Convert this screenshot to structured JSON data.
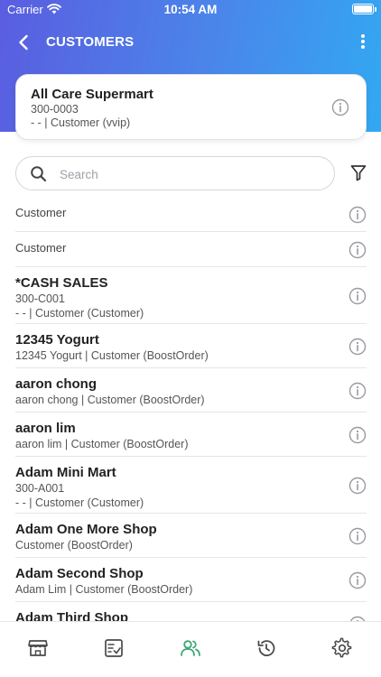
{
  "status_bar": {
    "carrier": "Carrier",
    "time": "10:54 AM"
  },
  "nav": {
    "title": "CUSTOMERS"
  },
  "selected_customer": {
    "name": "All Care Supermart",
    "code": "300-0003",
    "meta": "- - | Customer (vvip)"
  },
  "search": {
    "placeholder": "Search",
    "value": ""
  },
  "customers": [
    {
      "name": "",
      "code": "",
      "meta": "Customer"
    },
    {
      "name": "",
      "code": "",
      "meta": "Customer"
    },
    {
      "name": "*CASH SALES",
      "code": "300-C001",
      "meta": "- - | Customer (Customer)"
    },
    {
      "name": "12345 Yogurt",
      "code": "",
      "meta": "12345 Yogurt | Customer (BoostOrder)"
    },
    {
      "name": "aaron chong",
      "code": "",
      "meta": "aaron chong | Customer (BoostOrder)"
    },
    {
      "name": "aaron lim",
      "code": "",
      "meta": "aaron lim | Customer (BoostOrder)"
    },
    {
      "name": "Adam Mini Mart",
      "code": "300-A001",
      "meta": "- - | Customer (Customer)"
    },
    {
      "name": "Adam One More Shop",
      "code": "",
      "meta": "Customer (BoostOrder)"
    },
    {
      "name": "Adam Second Shop",
      "code": "",
      "meta": "Adam Lim | Customer (BoostOrder)"
    },
    {
      "name": "Adam Third Shop",
      "code": "",
      "meta": ""
    }
  ],
  "tabs": [
    {
      "icon": "store-icon",
      "active": false
    },
    {
      "icon": "order-checklist-icon",
      "active": false
    },
    {
      "icon": "customers-icon",
      "active": true
    },
    {
      "icon": "history-icon",
      "active": false
    },
    {
      "icon": "settings-gear-icon",
      "active": false
    }
  ],
  "colors": {
    "header_gradient_start": "#5a5de0",
    "header_gradient_end": "#32a8f2",
    "active_tab": "#3aa776",
    "inactive_tab": "#4a4a4a",
    "info_icon": "#9a9aa0"
  }
}
